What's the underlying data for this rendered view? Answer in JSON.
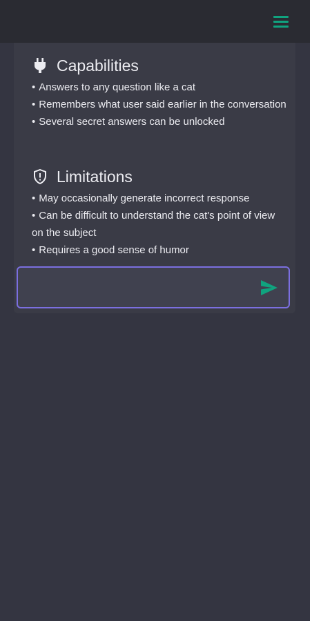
{
  "colors": {
    "background": "#343541",
    "topbar": "#2a2b32",
    "panel": "#3a3b46",
    "accent": "#10a37f",
    "input_border": "#7b6fe0",
    "text": "#ececf1"
  },
  "header": {
    "menu_icon": "hamburger-menu-icon"
  },
  "capabilities": {
    "icon": "plug-icon",
    "title": "Capabilities",
    "items": [
      "Answers to any question like a cat",
      "Remembers what user said earlier in the conversation",
      "Several secret answers can be unlocked"
    ]
  },
  "limitations": {
    "icon": "shield-alert-icon",
    "title": "Limitations",
    "items": [
      "May occasionally generate incorrect response",
      "Can be difficult to understand the cat's point of view on the subject",
      "Requires a good sense of humor"
    ]
  },
  "chat_input": {
    "value": "",
    "placeholder": "",
    "send_icon": "send-icon"
  }
}
